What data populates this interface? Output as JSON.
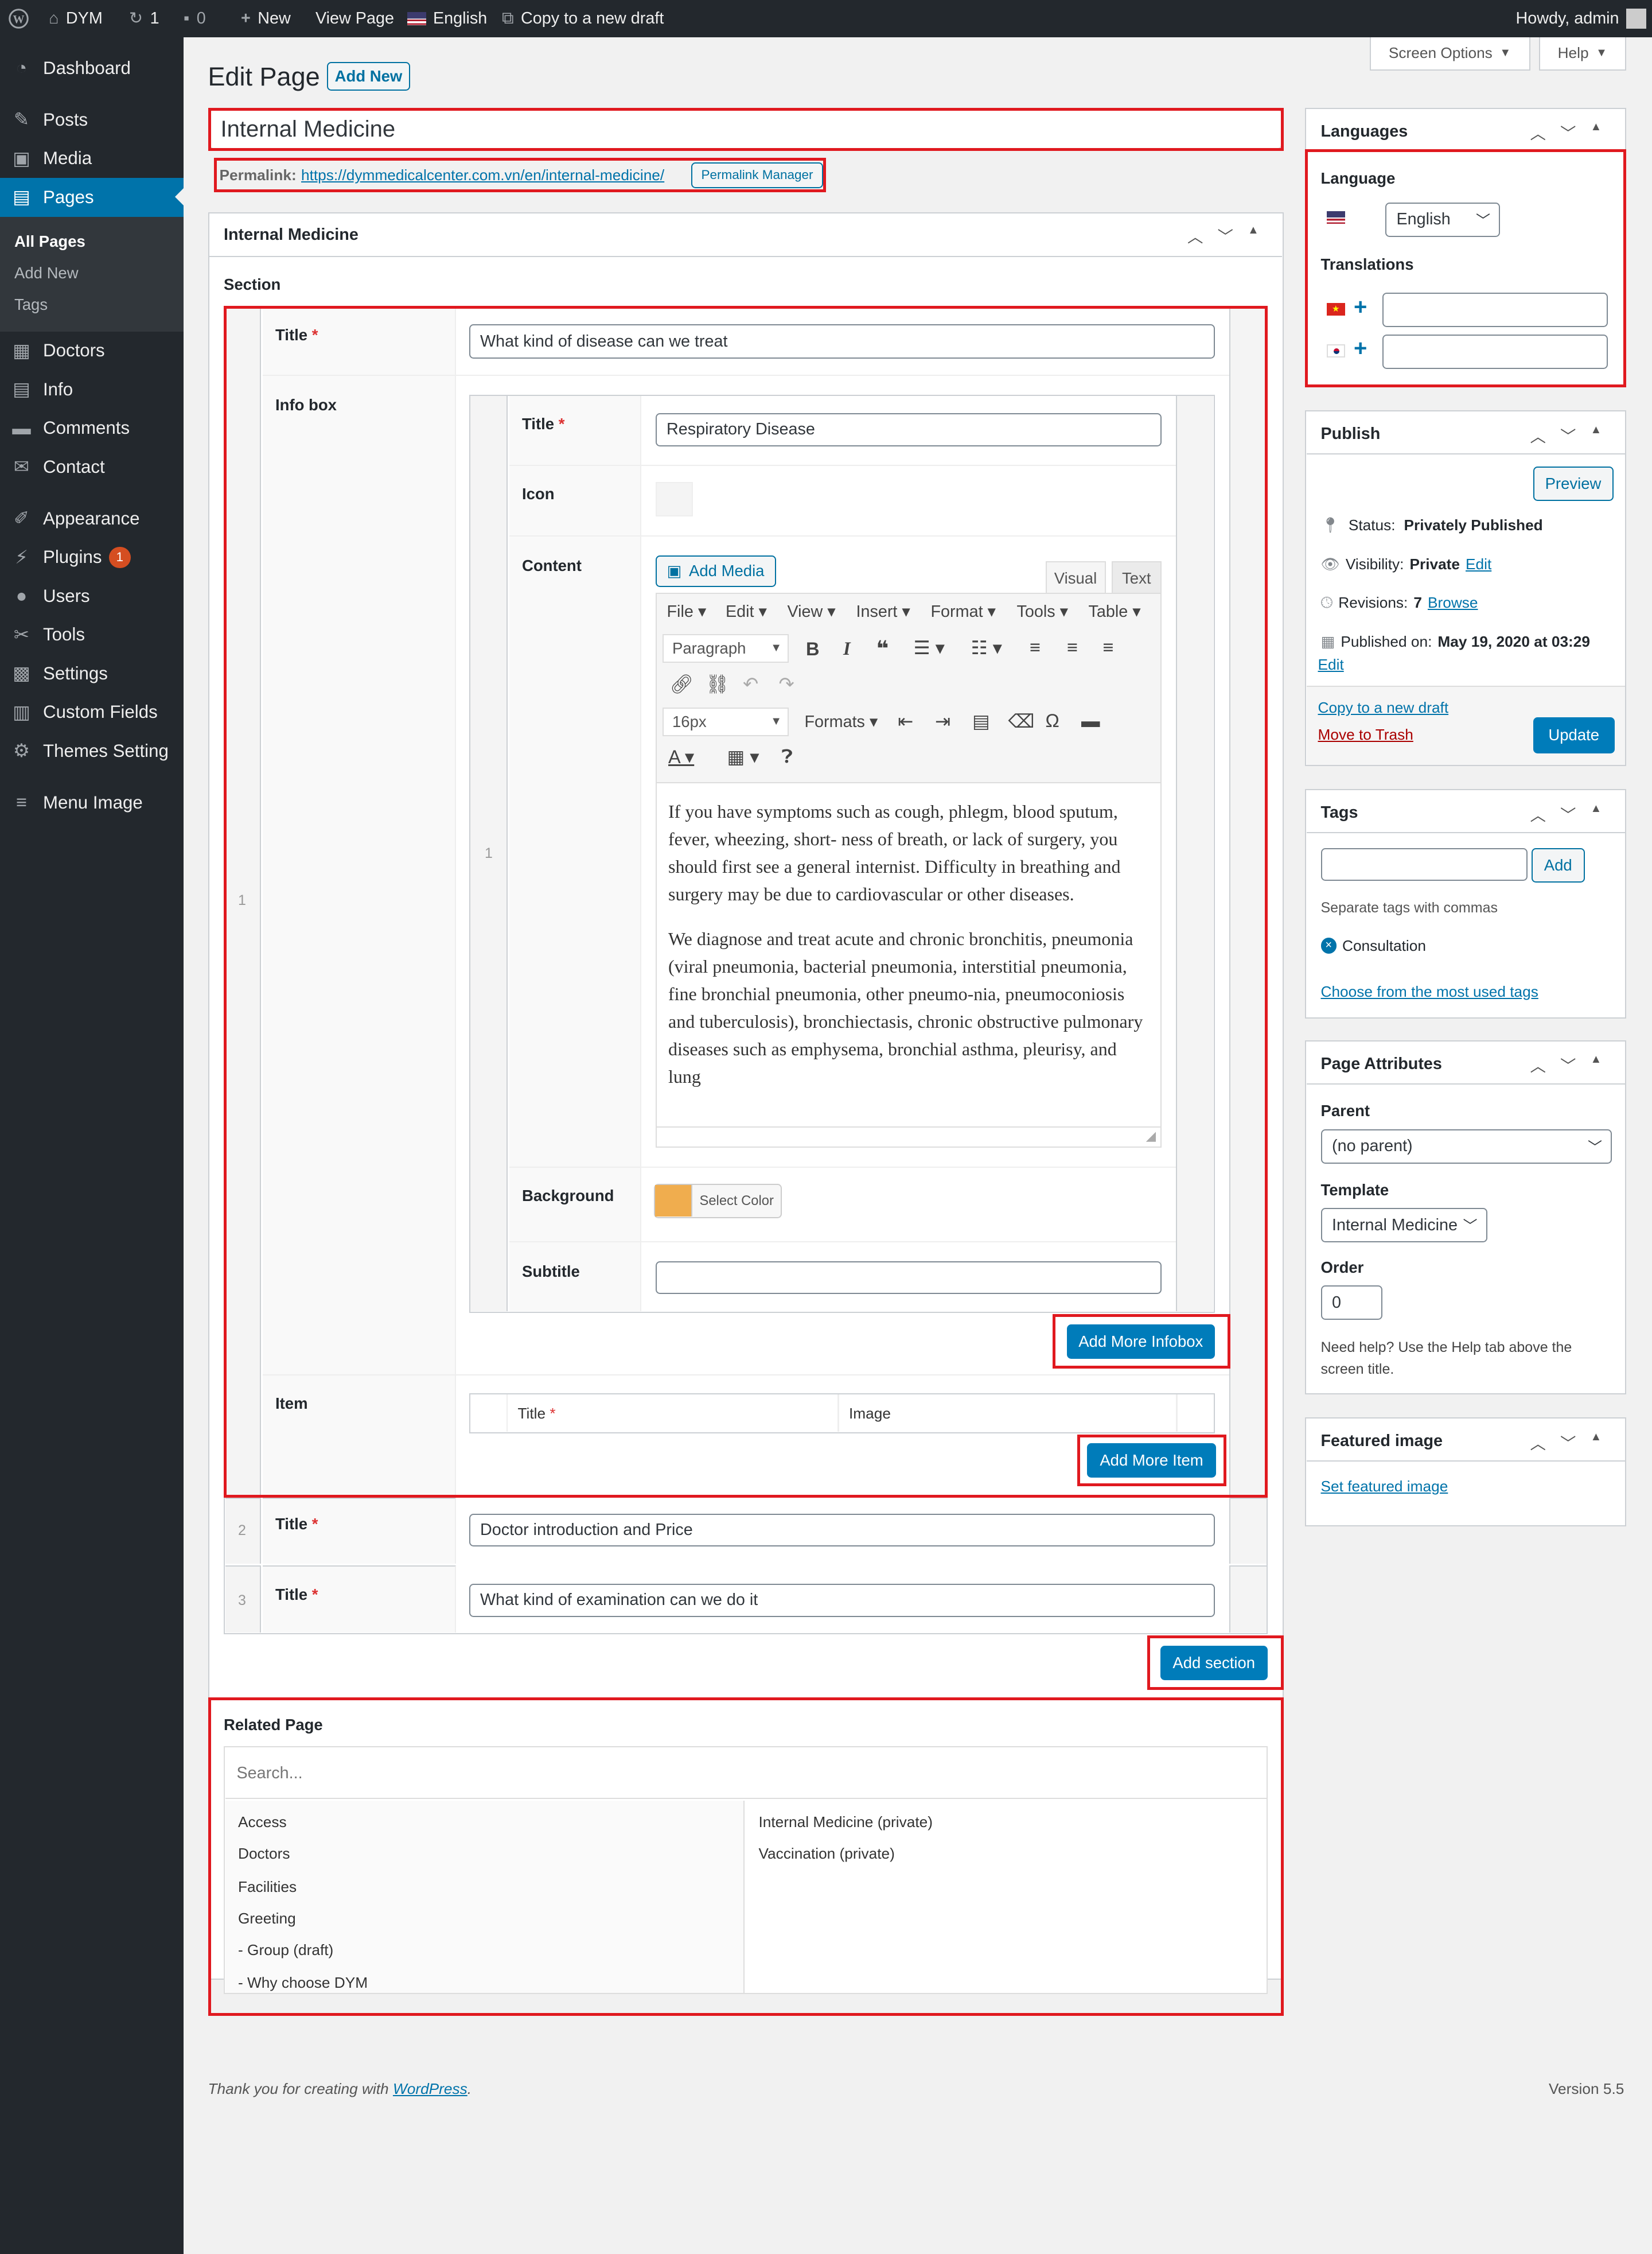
{
  "adminbar": {
    "site": "DYM",
    "updates": "1",
    "comments": "0",
    "new": "New",
    "view": "View Page",
    "lang": "English",
    "copy": "Copy to a new draft",
    "howdy": "Howdy, admin"
  },
  "menu": {
    "items": [
      "Dashboard",
      "Posts",
      "Media",
      "Pages",
      "Doctors",
      "Info",
      "Comments",
      "Contact",
      "Appearance",
      "Plugins",
      "Users",
      "Tools",
      "Settings",
      "Custom Fields",
      "Themes Setting",
      "Menu Image"
    ],
    "plugins_badge": "1",
    "pages_sub": [
      "All Pages",
      "Add New",
      "Tags"
    ]
  },
  "header": {
    "title": "Edit Page",
    "add_new": "Add New",
    "screen_options": "Screen Options",
    "help": "Help"
  },
  "post": {
    "title": "Internal Medicine",
    "permalink_label": "Permalink:",
    "permalink_url": "https://dymmedicalcenter.com.vn/en/internal-medicine/",
    "permalink_btn": "Permalink Manager"
  },
  "meta": {
    "box_title": "Internal Medicine",
    "section_label": "Section",
    "row1": {
      "num": "1",
      "title_label": "Title",
      "title_value": "What kind of disease can we treat",
      "infobox_label": "Info box",
      "infobox": {
        "num": "1",
        "title_label": "Title",
        "title_value": "Respiratory Disease",
        "icon_label": "Icon",
        "content_label": "Content",
        "add_media": "Add Media",
        "visual": "Visual",
        "text": "Text",
        "menus": [
          "File",
          "Edit",
          "View",
          "Insert",
          "Format",
          "Tools",
          "Table"
        ],
        "paragraph": "Paragraph",
        "fontsize": "16px",
        "formats": "Formats",
        "p1": "If you have symptoms such as cough, phlegm, blood sputum, fever, wheezing, short- ness of breath, or lack of surgery, you should first see a general internist. Difficulty in breathing and surgery may be due to cardiovascular or other diseases.",
        "p2": "We diagnose and treat acute and chronic bronchitis, pneumonia (viral pneumonia, bacterial pneumonia, interstitial pneumonia, fine bronchial pneumonia, other pneumo-nia, pneumoconiosis and tuberculosis), bronchiectasis, chronic obstructive pulmonary diseases such as emphysema, bronchial asthma, pleurisy, and lung",
        "background_label": "Background",
        "select_color": "Select Color",
        "bg_color": "#f0ad4e",
        "subtitle_label": "Subtitle"
      },
      "add_infobox": "Add More Infobox",
      "item_label": "Item",
      "item_col_title": "Title",
      "item_col_image": "Image",
      "add_item": "Add More Item"
    },
    "row2": {
      "num": "2",
      "title_label": "Title",
      "title_value": "Doctor introduction and Price"
    },
    "row3": {
      "num": "3",
      "title_label": "Title",
      "title_value": "What kind of examination can we do it"
    },
    "add_section": "Add section"
  },
  "related": {
    "label": "Related Page",
    "search_placeholder": "Search...",
    "left": [
      "Access",
      "Doctors",
      "Facilities",
      "Greeting",
      "- Group (draft)",
      "- Why choose DYM"
    ],
    "right": [
      "Internal Medicine (private)",
      "Vaccination (private)"
    ]
  },
  "languages": {
    "title": "Languages",
    "language_label": "Language",
    "language_value": "English",
    "translations_label": "Translations"
  },
  "publish": {
    "title": "Publish",
    "preview": "Preview",
    "status_label": "Status:",
    "status": "Privately Published",
    "visibility_label": "Visibility:",
    "visibility": "Private",
    "edit": "Edit",
    "revisions_label": "Revisions:",
    "revisions": "7",
    "browse": "Browse",
    "published_label": "Published on:",
    "published": "May 19, 2020 at 03:29",
    "copy": "Copy to a new draft",
    "trash": "Move to Trash",
    "update": "Update"
  },
  "tags": {
    "title": "Tags",
    "add": "Add",
    "hint": "Separate tags with commas",
    "tag": "Consultation",
    "choose": "Choose from the most used tags"
  },
  "attributes": {
    "title": "Page Attributes",
    "parent_label": "Parent",
    "parent": "(no parent)",
    "template_label": "Template",
    "template": "Internal Medicine",
    "order_label": "Order",
    "order": "0",
    "help": "Need help? Use the Help tab above the screen title."
  },
  "featured": {
    "title": "Featured image",
    "set": "Set featured image"
  },
  "footer": {
    "thanks": "Thank you for creating with",
    "wp": "WordPress",
    "version": "Version 5.5"
  },
  "colors": {
    "accent": "#0073aa",
    "highlight": "#e0191f",
    "adminbar": "#23282d"
  }
}
